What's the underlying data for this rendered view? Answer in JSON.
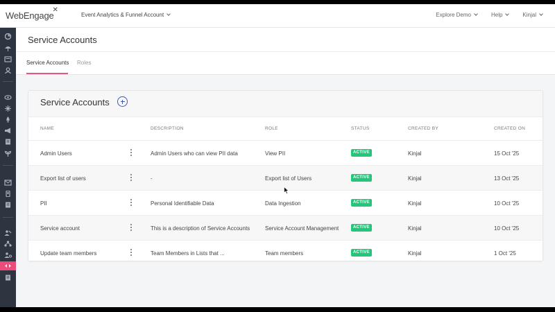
{
  "app": {
    "logo": "WebEngage",
    "account": "Event Analytics & Funnel Account"
  },
  "topbar": {
    "menu": [
      "Explore Demo",
      "Help",
      "Kinjal"
    ]
  },
  "sidebar": {
    "icons": [
      "dashboard-icon",
      "umbrella-icon",
      "inbox-icon",
      "users-icon",
      "eye-icon",
      "sparkle-icon",
      "rocket-icon",
      "megaphone-icon",
      "report-icon",
      "plant-icon",
      "mail-icon",
      "mobile-icon",
      "list-icon",
      "team-icon",
      "org-icon",
      "user-settings-icon",
      "service-accounts-icon",
      "document-icon"
    ],
    "active": "service-accounts-icon"
  },
  "page": {
    "title": "Service Accounts",
    "tabs": [
      {
        "label": "Service Accounts",
        "active": true
      },
      {
        "label": "Roles",
        "active": false
      }
    ]
  },
  "card": {
    "title": "Service Accounts",
    "columns": [
      "NAME",
      "DESCRIPTION",
      "ROLE",
      "STATUS",
      "CREATED BY",
      "CREATED ON"
    ],
    "rows": [
      {
        "name": "Admin Users",
        "description": "Admin Users who can view PII data",
        "role": "View PII",
        "status": "ACTIVE",
        "created_by": "Kinjal",
        "created_on": "15 Oct '25"
      },
      {
        "name": "Export list of users",
        "description": "-",
        "role": "Export list of Users",
        "status": "ACTIVE",
        "created_by": "Kinjal",
        "created_on": "13 Oct '25"
      },
      {
        "name": "PII",
        "description": "Personal Identifiable Data",
        "role": "Data Ingestion",
        "status": "ACTIVE",
        "created_by": "Kinjal",
        "created_on": "10 Oct '25"
      },
      {
        "name": "Service account",
        "description": "This is a description of Service Accounts",
        "role": "Service Account Management",
        "status": "ACTIVE",
        "created_by": "Kinjal",
        "created_on": "10 Oct '25"
      },
      {
        "name": "Update team members",
        "description": "Team Members in Lists that ...",
        "role": "Team members",
        "status": "ACTIVE",
        "created_by": "Kinjal",
        "created_on": "1 Oct '25"
      }
    ]
  },
  "colors": {
    "accent": "#e85585",
    "status_active": "#22c77a",
    "sidebar_bg": "#2f3441",
    "add_button": "#3f57b8"
  }
}
